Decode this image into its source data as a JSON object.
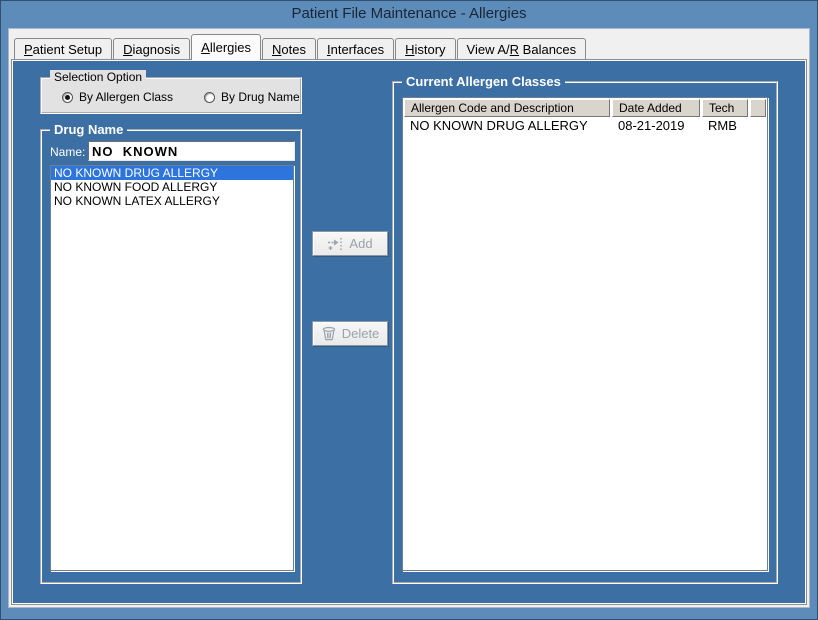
{
  "window": {
    "title": "Patient File Maintenance - Allergies"
  },
  "tabs": [
    {
      "label": "Patient Setup",
      "accel": "P",
      "active": false
    },
    {
      "label": "Diagnosis",
      "accel": "D",
      "active": false
    },
    {
      "label": "Allergies",
      "accel": "A",
      "active": true
    },
    {
      "label": "Notes",
      "accel": "N",
      "active": false
    },
    {
      "label": "Interfaces",
      "accel": "I",
      "active": false
    },
    {
      "label": "History",
      "accel": "H",
      "active": false
    },
    {
      "label": "View A/R Balances",
      "accel": "R",
      "active": false
    }
  ],
  "selection_option": {
    "legend": "Selection Option",
    "options": [
      {
        "label": "By Allergen Class",
        "selected": true
      },
      {
        "label": "By Drug Name",
        "selected": false
      }
    ]
  },
  "drug_name": {
    "legend": "Drug Name",
    "name_label": "Name:",
    "name_value": "NO  KNOWN",
    "items": [
      "NO KNOWN DRUG ALLERGY",
      "NO KNOWN FOOD ALLERGY",
      "NO KNOWN LATEX ALLERGY"
    ],
    "selected_index": 0
  },
  "actions": {
    "add_label": "Add",
    "delete_label": "Delete"
  },
  "current_allergens": {
    "legend": "Current Allergen Classes",
    "columns": [
      "Allergen Code and Description",
      "Date Added",
      "Tech"
    ],
    "rows": [
      [
        "NO KNOWN DRUG ALLERGY",
        "08-21-2019",
        "RMB"
      ]
    ]
  },
  "colors": {
    "titlebar": "#5d8cbb",
    "page_blue": "#3c6fa4",
    "selection_highlight": "#2d74dc",
    "header_gray": "#d9d5cd"
  }
}
